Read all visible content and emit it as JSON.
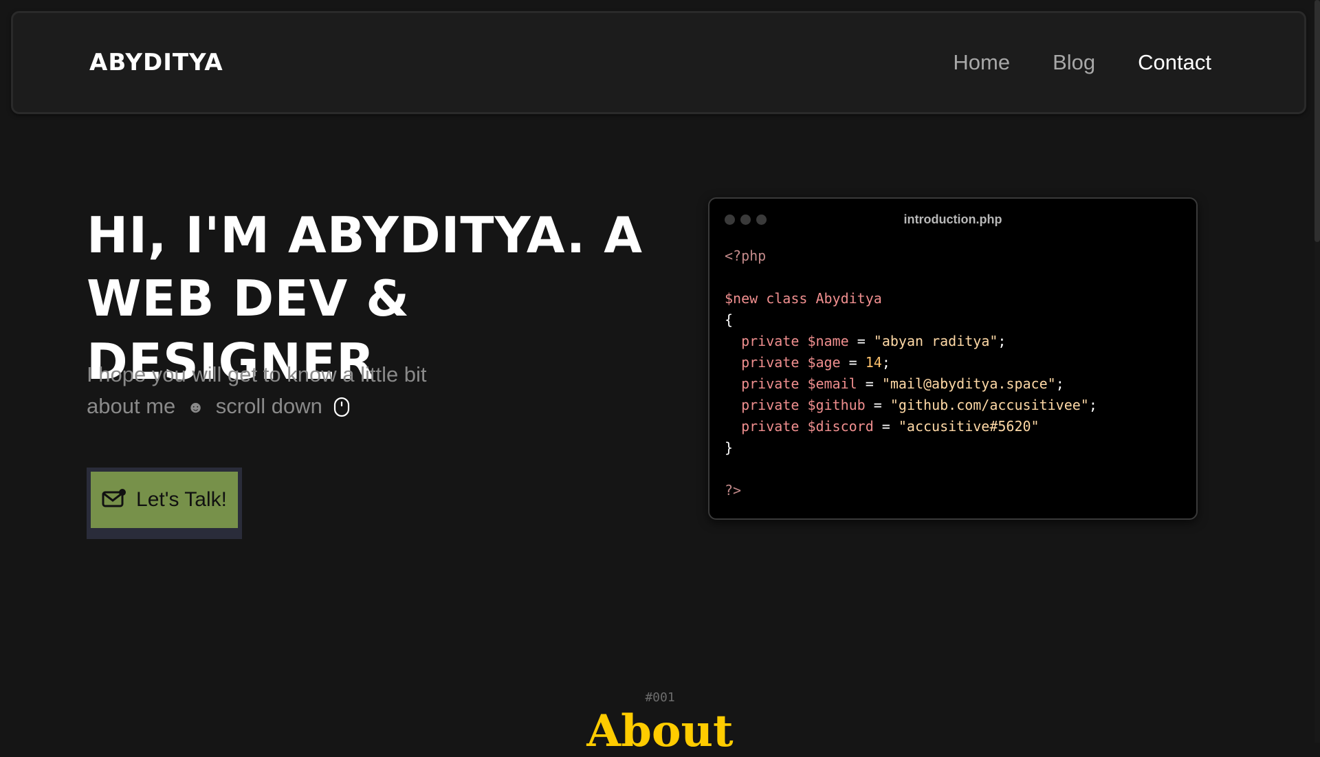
{
  "nav": {
    "logo": "ABYDITYA",
    "links": [
      "Home",
      "Blog",
      "Contact"
    ]
  },
  "hero": {
    "title_line1": "HI, I'M ABYDITYA. A",
    "title_line2": "WEB DEV & DESIGNER",
    "sub_line1": "I hope you will get to know a little bit",
    "sub_line2_a": "about me",
    "smile": "☻",
    "sub_line2_b": "scroll down",
    "cta_label": "Let's Talk!"
  },
  "code": {
    "filename": "introduction.php",
    "open_tag": "<?php",
    "class_kw": "$new class",
    "class_name": "Abyditya",
    "brace_open": "{",
    "brace_close": "}",
    "close_tag": "?>",
    "fields": [
      {
        "kw": "private",
        "var": "$name",
        "eq": " = ",
        "val": "\"abyan raditya\"",
        "end": ";"
      },
      {
        "kw": "private",
        "var": "$age",
        "eq": " = ",
        "val": "14",
        "end": ";"
      },
      {
        "kw": "private",
        "var": "$email",
        "eq": " = ",
        "val": "\"mail@abyditya.space\"",
        "end": ";"
      },
      {
        "kw": "private",
        "var": "$github",
        "eq": " = ",
        "val": "\"github.com/accusitivee\"",
        "end": ";"
      },
      {
        "kw": "private",
        "var": "$discord",
        "eq": " = ",
        "val": "\"accusitive#5620\"",
        "end": ""
      }
    ]
  },
  "about": {
    "number": "#001",
    "title": "About"
  },
  "colors": {
    "background": "#151515",
    "cta_green": "#77914a",
    "about_yellow": "#ffcc00",
    "code_pink": "#f08f8f"
  }
}
